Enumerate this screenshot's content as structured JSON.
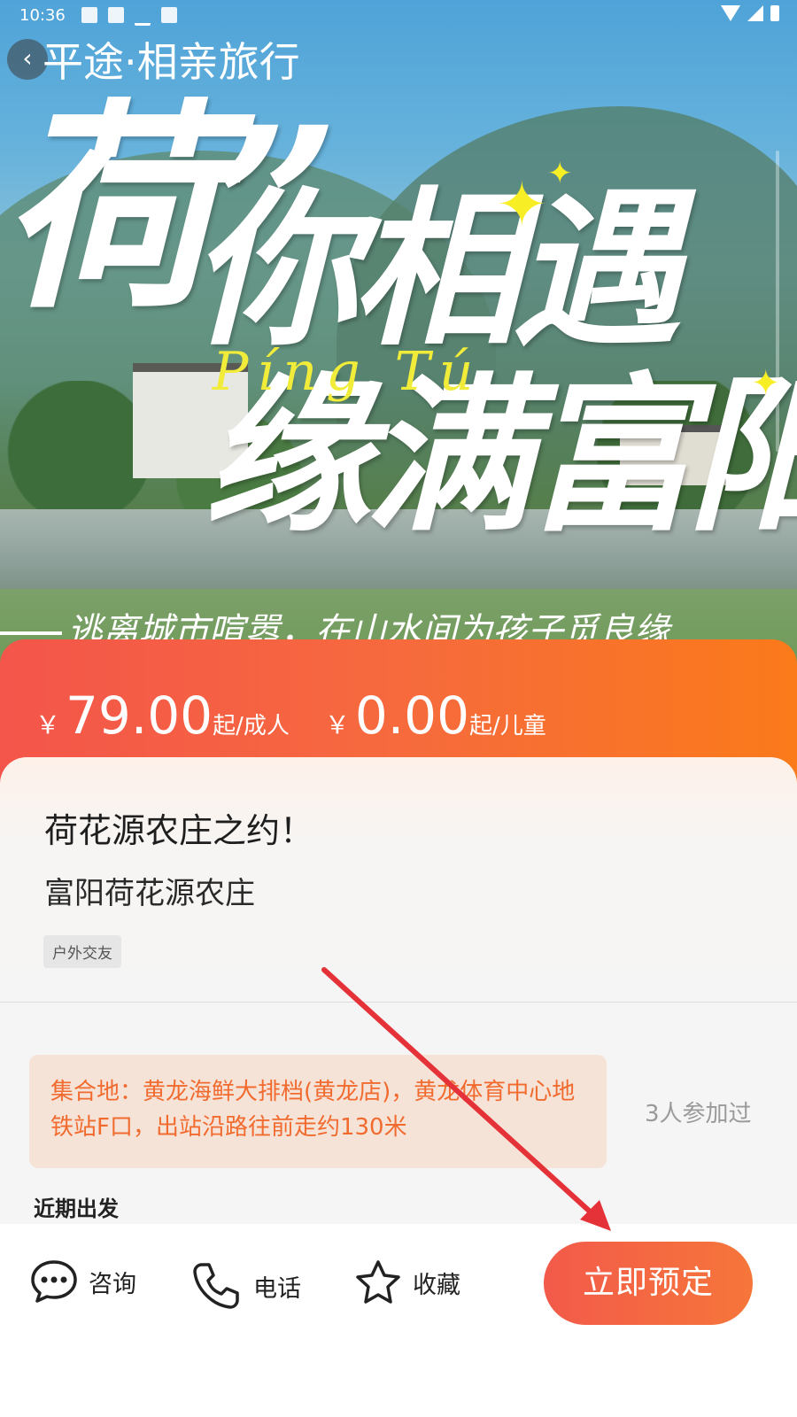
{
  "status_bar": {
    "time": "10:36"
  },
  "header": {
    "title": "平途·相亲旅行",
    "back_icon": "chevron-left-icon"
  },
  "banner": {
    "calligraphy_line1": "荷”",
    "calligraphy_line2": "你相遇",
    "calligraphy_line3": "缘满富阳",
    "pingtu": "Píng Tú",
    "slogan": "逃离城市喧嚣，在山水间为孩子觅良缘"
  },
  "price": {
    "currency": "￥",
    "adult_price": "79.00",
    "adult_unit": "起/成人",
    "child_price": "0.00",
    "child_unit": "起/儿童"
  },
  "trip": {
    "title": "荷花源农庄之约！",
    "subtitle": "富阳荷花源农庄",
    "tag": "户外交友"
  },
  "meeting": {
    "text": "集合地：黄龙海鲜大排档(黄龙店)，黄龙体育中心地铁站F口，出站沿路往前走约130米",
    "attended": "3人参加过"
  },
  "recent_departure": "近期出发",
  "bottom_bar": {
    "consult_label": "咨询",
    "phone_label": "电话",
    "favorite_label": "收藏",
    "book_label": "立即预定"
  },
  "colors": {
    "accent_orange": "#f6763a",
    "price_gradient_start": "#f4554b",
    "price_gradient_end": "#fb7a1a",
    "meeting_text": "#f16b2f",
    "meeting_bg": "#f6e3d8",
    "annotation_arrow": "#e53238"
  }
}
